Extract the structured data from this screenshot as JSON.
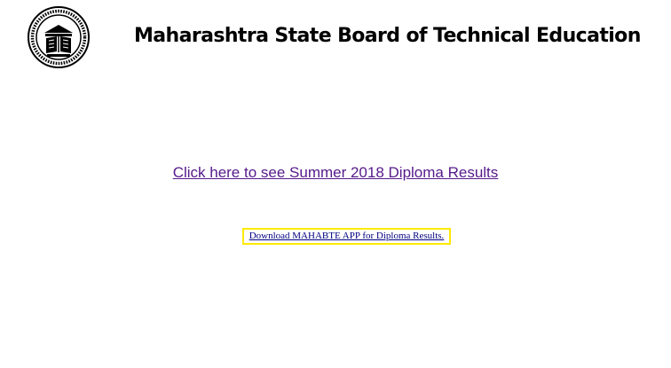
{
  "header": {
    "title": "Maharashtra State Board of Technical Education",
    "logo_icon": "msbte-seal-icon"
  },
  "main": {
    "results_link": "Click here to see Summer 2018 Diploma Results",
    "app_link": "Download MAHABTE APP for Diploma Results."
  },
  "colors": {
    "visited_link": "#551a8b",
    "app_link": "#000080",
    "highlight_border": "#ffea00"
  }
}
